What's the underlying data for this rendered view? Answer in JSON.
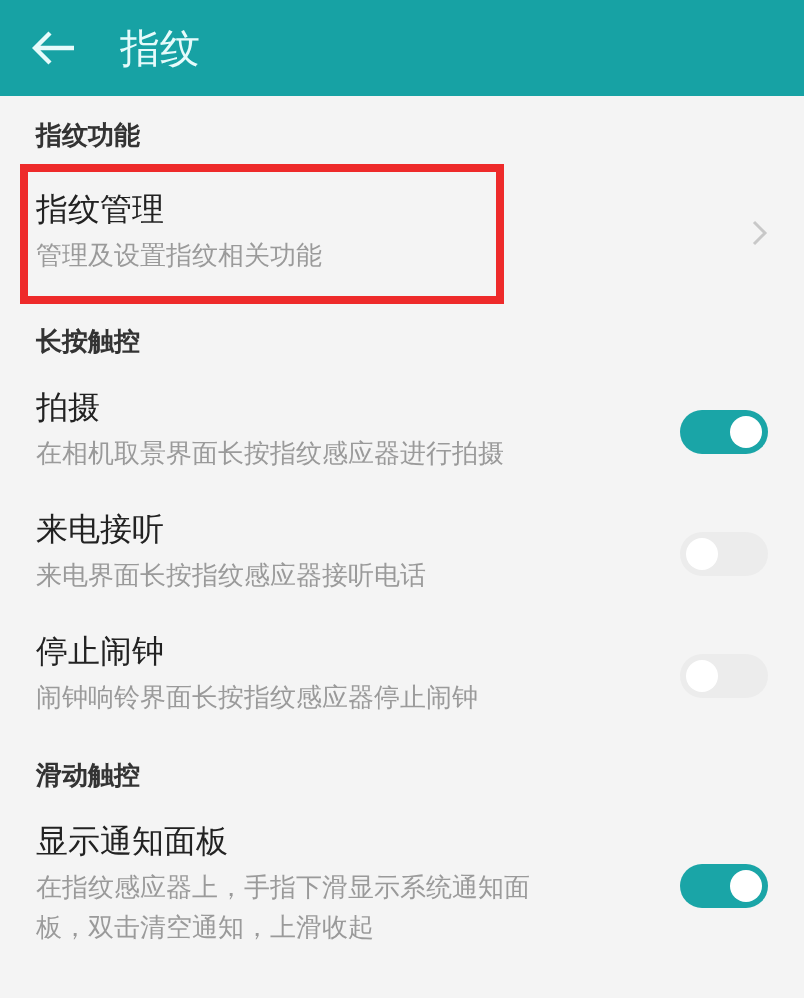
{
  "header": {
    "title": "指纹"
  },
  "sections": [
    {
      "title": "指纹功能",
      "items": [
        {
          "kind": "link",
          "title": "指纹管理",
          "subtitle": "管理及设置指纹相关功能",
          "highlighted": true
        }
      ]
    },
    {
      "title": "长按触控",
      "items": [
        {
          "kind": "switch",
          "title": "拍摄",
          "subtitle": "在相机取景界面长按指纹感应器进行拍摄",
          "on": true,
          "highlighted": false
        },
        {
          "kind": "switch",
          "title": "来电接听",
          "subtitle": "来电界面长按指纹感应器接听电话",
          "on": false,
          "highlighted": false
        },
        {
          "kind": "switch",
          "title": "停止闹钟",
          "subtitle": "闹钟响铃界面长按指纹感应器停止闹钟",
          "on": false,
          "highlighted": false
        }
      ]
    },
    {
      "title": "滑动触控",
      "items": [
        {
          "kind": "switch",
          "title": "显示通知面板",
          "subtitle": "在指纹感应器上，手指下滑显示系统通知面板，双击清空通知，上滑收起",
          "on": true,
          "highlighted": false
        }
      ]
    }
  ]
}
